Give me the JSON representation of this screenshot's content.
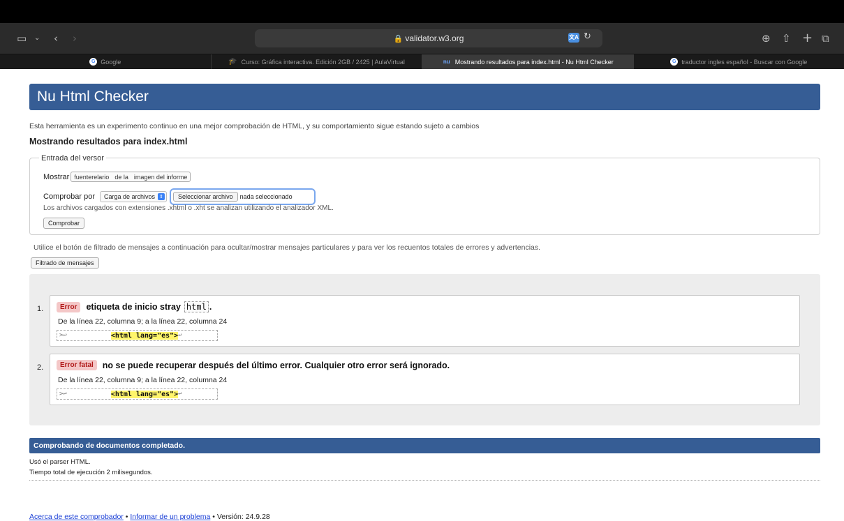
{
  "browser": {
    "url": "validator.w3.org",
    "tabs": [
      {
        "label": "Google",
        "favicon": "google-icon",
        "active": false
      },
      {
        "label": "Curso: Gráfica interactiva. Edición 2GB / 2425 | AulaVirtual",
        "favicon": "graduation-cap-icon",
        "active": false
      },
      {
        "label": "Mostrando resultados para index.html - Nu Html Checker",
        "favicon": "nu-icon",
        "active": true
      },
      {
        "label": "traductor ingles español - Buscar con Google",
        "favicon": "google-icon",
        "active": false
      }
    ]
  },
  "page": {
    "title": "Nu Html Checker",
    "intro": "Esta herramienta es un experimento continuo en una mejor comprobación de HTML, y su comportamiento sigue estando sujeto a cambios",
    "results_title": "Mostrando resultados para index.html",
    "form": {
      "legend": "Entrada del versor",
      "show_label": "Mostrar",
      "show_options": [
        "fuenterelario",
        "de la",
        "imagen del informe"
      ],
      "check_by_label": "Comprobar por",
      "check_by_value": "Carga de archivos",
      "file_button": "Seleccionar archivo",
      "file_status": "nada seleccionado",
      "note": "Los archivos cargados con extensiones .xhtml o .xht se analizan utilizando el analizador XML.",
      "submit": "Comprobar"
    },
    "filter": {
      "text": "Utilice el botón de filtrado de mensajes a continuación para ocultar/mostrar mensajes particulares y para ver los recuentos totales de errores y advertencias.",
      "button": "Filtrado de mensajes"
    },
    "messages": [
      {
        "num": "1.",
        "badge": "Error",
        "text": "etiqueta de inicio stray",
        "code": "html",
        "suffix": ".",
        "location": "De la línea 22, columna 9; a la línea 22, columna 24",
        "extract_pre": ">↩",
        "extract_hl": "<html lang=\"es\">",
        "extract_post": "↩"
      },
      {
        "num": "2.",
        "badge": "Error fatal",
        "text": "no se puede recuperar después del último error. Cualquier otro error será ignorado.",
        "location": "De la línea 22, columna 9; a la línea 22, columna 24",
        "extract_pre": ">↩",
        "extract_hl": "<html lang=\"es\">",
        "extract_post": "↩"
      }
    ],
    "footer": {
      "status": "Comprobando de documentos completado.",
      "parser": "Usó el parser HTML.",
      "time": "Tiempo total de ejecución 2 milisegundos.",
      "about_link": "Acerca de este comprobador",
      "separator": "•",
      "report_link": "Informar de un problema",
      "version": "• Versión: 24.9.28"
    }
  },
  "colors": {
    "header_blue": "#365d95",
    "error_badge_bg": "#f4c7c7",
    "error_badge_text": "#b01818",
    "highlight": "#fff56b",
    "link": "#1a3fd6"
  }
}
